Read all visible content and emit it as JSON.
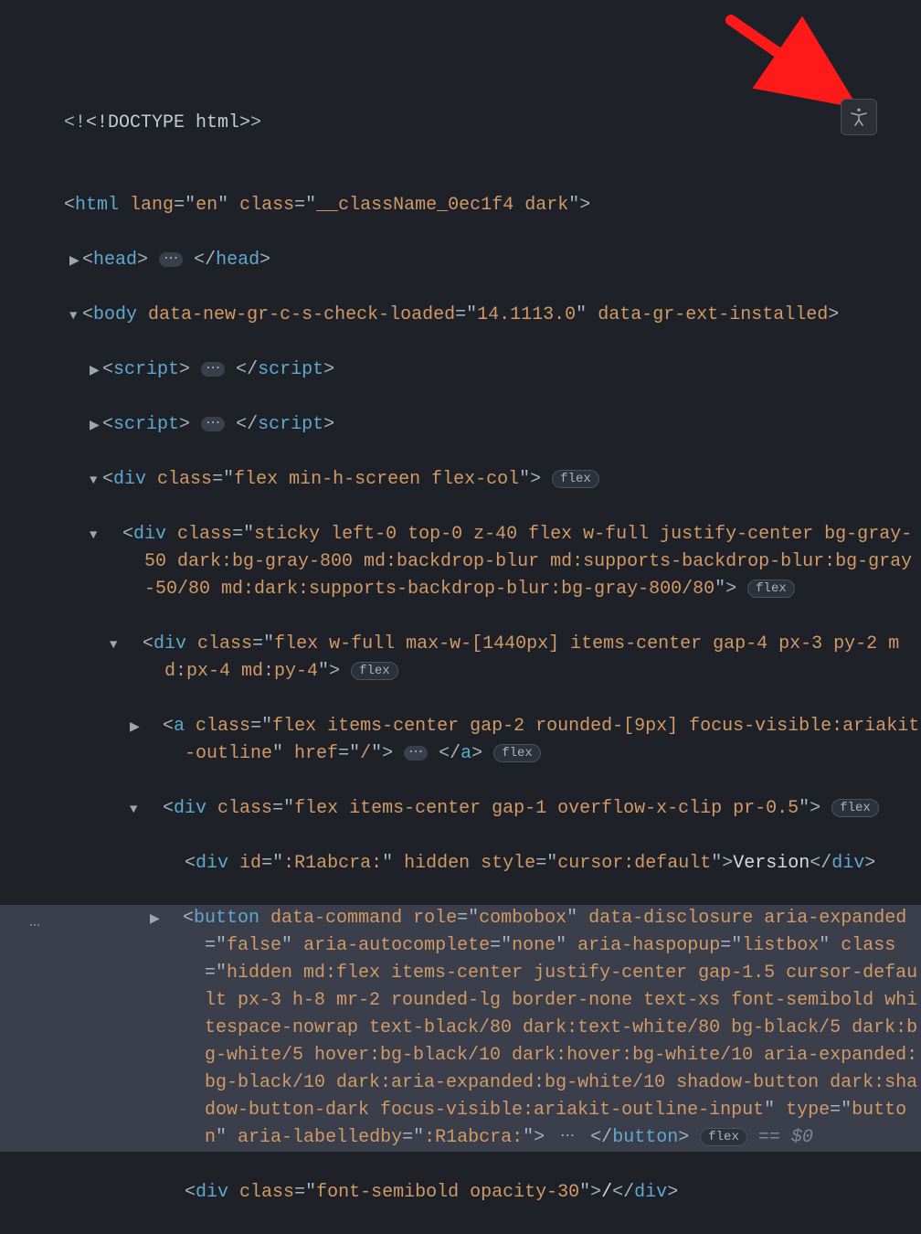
{
  "doctype": "<!DOCTYPE html>",
  "html_tag": "html",
  "html_attrs": {
    "lang_name": "lang",
    "lang_val": "en",
    "class_name": "class",
    "class_val": "__className_0ec1f4 dark"
  },
  "head_open": "head",
  "head_close": "head",
  "body_tag": "body",
  "body_attrs": {
    "a1_name": "data-new-gr-c-s-check-loaded",
    "a1_val": "14.1113.0",
    "a2_name": "data-gr-ext-installed"
  },
  "script_tag": "script",
  "div_tag": "div",
  "a_tag": "a",
  "button_tag": "button",
  "class_attr": "class",
  "href_attr": "href",
  "id_attr": "id",
  "hidden_attr": "hidden",
  "style_attr": "style",
  "type_attr": "type",
  "role_attr": "role",
  "data_command_attr": "data-command",
  "data_disclosure_attr": "data-disclosure",
  "aria_expanded_attr": "aria-expanded",
  "aria_autocomplete_attr": "aria-autocomplete",
  "aria_haspopup_attr": "aria-haspopup",
  "aria_labelledby_attr": "aria-labelledby",
  "div1_class": "flex min-h-screen flex-col",
  "div2_class": "sticky left-0 top-0 z-40 flex w-full justify-center bg-gray-50 dark:bg-gray-800 md:backdrop-blur md:supports-backdrop-blur:bg-gray-50/80 md:dark:supports-backdrop-blur:bg-gray-800/80",
  "div3_class": "flex w-full max-w-[1440px] items-center gap-4 px-3 py-2 md:px-4 md:py-4",
  "a_class": "flex items-center gap-2 rounded-[9px] focus-visible:ariakit-outline",
  "a_href": "/",
  "div4_class": "flex items-center gap-1 overflow-x-clip pr-0.5",
  "div5_id": ":R1abcra:",
  "div5_style": "cursor:default",
  "div5_text": "Version",
  "button_role": "combobox",
  "button_aria_expanded": "false",
  "button_aria_autocomplete": "none",
  "button_aria_haspopup": "listbox",
  "button_class": "hidden md:flex items-center justify-center gap-1.5 cursor-default px-3 h-8 mr-2 rounded-lg border-none text-xs font-semibold whitespace-nowrap text-black/80 dark:text-white/80 bg-black/5 dark:bg-white/5 hover:bg-black/10 dark:hover:bg-white/10 aria-expanded:bg-black/10 dark:aria-expanded:bg-white/10 shadow-button dark:shadow-button-dark focus-visible:ariakit-outline-input",
  "button_type": "button",
  "button_aria_labelledby": ":R1abcra:",
  "div6_class": "font-semibold opacity-30",
  "div6_text": "/",
  "flex_badge": "flex",
  "eq_dollar": "== ",
  "dollar0": "$0"
}
